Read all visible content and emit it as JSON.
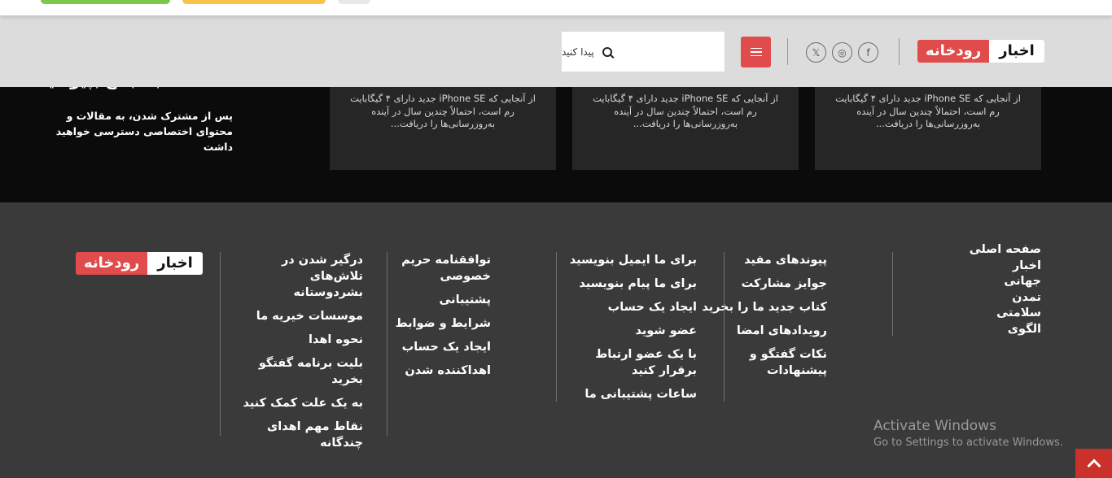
{
  "header": {
    "logo": {
      "word_white": "اخبار",
      "word_red": "رودخانه"
    },
    "social": {
      "facebook": "f",
      "instagram": "◎",
      "x": "𝕏"
    },
    "search_placeholder": "پیدا کنید"
  },
  "band": {
    "subscribe_heading": "به جمع بپیوندید",
    "subscribe_text": "پس از مشترک شدن، به مقالات و محتوای اختصاصی دسترسی خواهید داشت",
    "cards": [
      {
        "excerpt": "از آنجایی که iPhone SE جدید دارای ۴ گیگابایت رم است، احتمالاً چندین سال در آینده به‌روزرسانی‌ها را دریافت..."
      },
      {
        "excerpt": "از آنجایی که iPhone SE جدید دارای ۴ گیگابایت رم است، احتمالاً چندین سال در آینده به‌روزرسانی‌ها را دریافت..."
      },
      {
        "excerpt": "از آنجایی که iPhone SE جدید دارای ۴ گیگابایت رم است، احتمالاً چندین سال در آینده به‌روزرسانی‌ها را دریافت..."
      }
    ]
  },
  "footer": {
    "logo": {
      "word_white": "اخبار",
      "word_red": "رودخانه"
    },
    "nav": [
      "صفحه اصلی",
      "اخبار",
      "جهانی",
      "تمدن",
      "سلامتی",
      "الگوی"
    ],
    "col1": [
      "پیوندهای مفید",
      "جوایز مشارکت",
      "کتاب جدید ما را بخرید",
      "رویدادهای امضا",
      "نکات گفتگو و پیشنهادات"
    ],
    "col2": [
      "برای ما ایمیل بنویسید",
      "برای ما پیام بنویسید",
      "ایجاد یک حساب",
      "عضو شوید",
      "با یک عضو ارتباط برقرار کنید",
      "ساعات پشتیبانی ما"
    ],
    "col3": [
      "توافقنامه حریم خصوصی",
      "پشتیبانی",
      "شرایط و ضوابط",
      "ایجاد یک حساب",
      "اهداکننده شدن"
    ],
    "col4": [
      "درگیر شدن در تلاش‌های بشردوستانه",
      "موسسات خیریه ما",
      "نحوه اهدا",
      "بلیت برنامه گفتگو بخرید",
      "به یک علت کمک کنید",
      "نقاط مهم اهدای چندگانه"
    ]
  },
  "windows": {
    "title": "Activate Windows",
    "subtitle": "Go to Settings to activate Windows."
  }
}
